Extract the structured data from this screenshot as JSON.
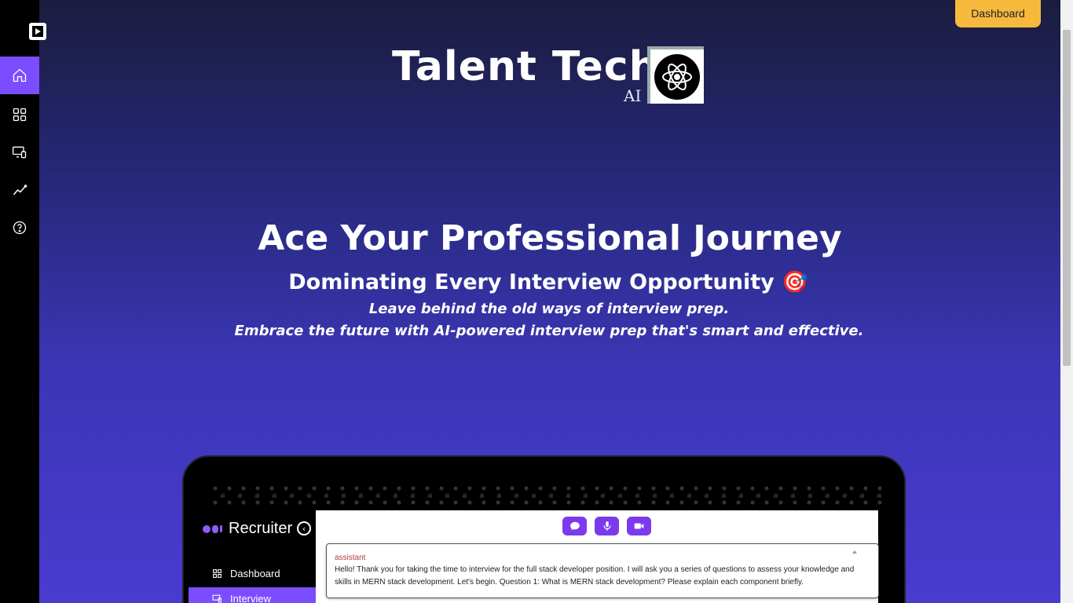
{
  "sidebar": {
    "items": [
      {
        "icon": "home-icon",
        "active": true
      },
      {
        "icon": "grid-icon",
        "active": false
      },
      {
        "icon": "monitor-device-icon",
        "active": false
      },
      {
        "icon": "analytics-icon",
        "active": false
      },
      {
        "icon": "help-icon",
        "active": false
      }
    ]
  },
  "header": {
    "dashboard_label": "Dashboard"
  },
  "brand": {
    "name": "Talent Tech",
    "suffix": "AI",
    "logo_icon": "atom-icon"
  },
  "hero": {
    "title": "Ace Your Professional Journey",
    "subtitle": "Dominating Every Interview Opportunity 🎯",
    "line1": "Leave behind the old ways of interview prep.",
    "line2": "Embrace the future with AI-powered interview prep that's smart and effective."
  },
  "preview": {
    "brand": "Recruiter",
    "nav": [
      {
        "label": "Dashboard",
        "icon": "grid-icon",
        "active": false
      },
      {
        "label": "Interview",
        "icon": "monitor-device-icon",
        "active": true
      }
    ],
    "controls": [
      "chat-icon",
      "mic-icon",
      "video-icon"
    ],
    "message": {
      "role": "assistant",
      "text": "Hello! Thank you for taking the time to interview for the full stack developer position. I will ask you a series of questions to assess your knowledge and skills in MERN stack development. Let's begin. Question 1: What is MERN stack development? Please explain each component briefly."
    }
  },
  "colors": {
    "accent": "#7c4dff",
    "button": "#f6b93b",
    "sidebar_bg": "#000000"
  }
}
